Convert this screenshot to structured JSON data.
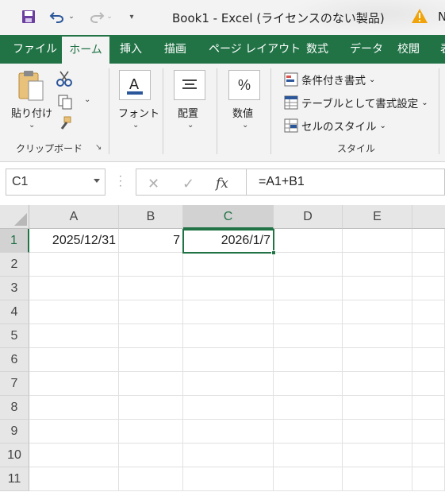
{
  "title": {
    "text": "Book1  -  Excel (ライセンスのない製品)",
    "clipped": "N"
  },
  "tabs": [
    "ファイル",
    "ホーム",
    "挿入",
    "描画",
    "ページ レイアウト",
    "数式",
    "データ",
    "校閲",
    "表"
  ],
  "ribbon": {
    "clipboard": {
      "paste": "貼り付け",
      "group": "クリップボード"
    },
    "font": {
      "label": "フォント"
    },
    "alignment": {
      "label": "配置"
    },
    "number": {
      "label": "数値",
      "glyph": "%"
    },
    "styles": {
      "conditional": "条件付き書式",
      "as_table": "テーブルとして書式設定",
      "cell_styles": "セルのスタイル",
      "group": "スタイル"
    }
  },
  "formula_bar": {
    "name_box": "C1",
    "formula": "=A1+B1",
    "fx": "fx"
  },
  "columns": [
    "A",
    "B",
    "C",
    "D",
    "E"
  ],
  "rows": [
    "1",
    "2",
    "3",
    "4",
    "5",
    "6",
    "7",
    "8",
    "9",
    "10",
    "11"
  ],
  "cells": {
    "A1": "2025/12/31",
    "B1": "7",
    "C1": "2026/1/7"
  },
  "selected_cell": "C1",
  "colors": {
    "accent": "#217346",
    "qat": "#2b579a",
    "warning": "#f0a30a"
  }
}
